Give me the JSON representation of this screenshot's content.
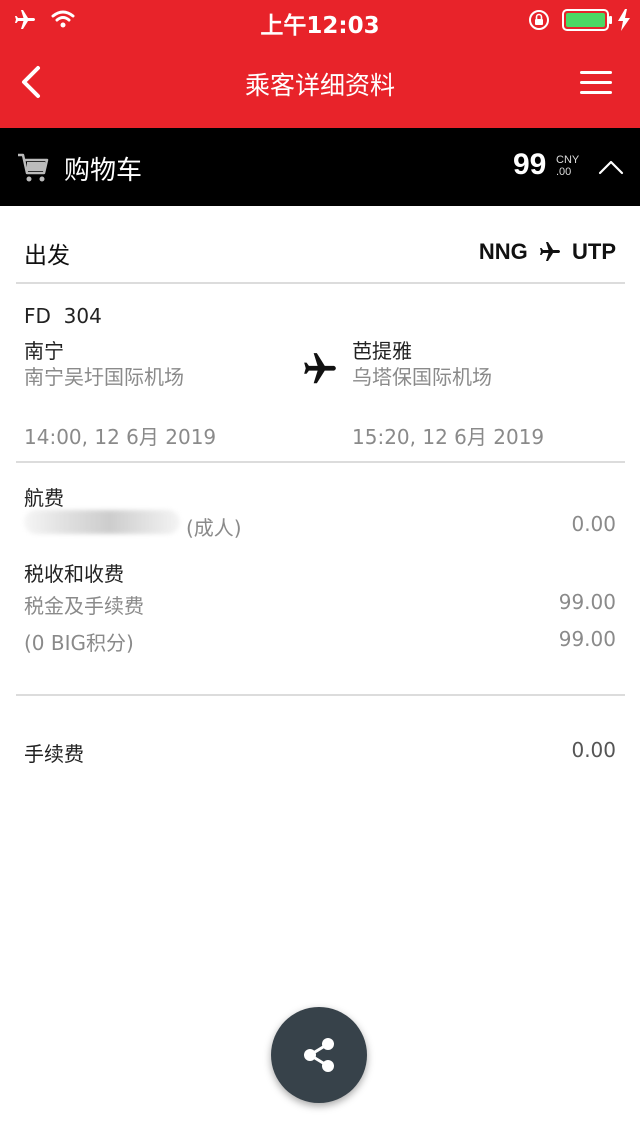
{
  "status_bar": {
    "time": "上午12:03",
    "icons": [
      "airplane-mode-icon",
      "wifi-icon",
      "rotation-lock-icon",
      "battery-icon",
      "charging-icon"
    ]
  },
  "nav": {
    "title": "乘客详细资料"
  },
  "cart": {
    "label": "购物车",
    "amount": "99",
    "currency": "CNY",
    "decimals": ".00"
  },
  "departure": {
    "label": "出发",
    "origin_code": "NNG",
    "destination_code": "UTP",
    "flight_number": "FD  304",
    "origin_city": "南宁",
    "origin_airport": "南宁吴圩国际机场",
    "destination_city": "芭提雅",
    "destination_airport": "乌塔保国际机场",
    "depart_time": "14:00, 12 6月 2019",
    "arrive_time": "15:20, 12 6月 2019"
  },
  "fares": {
    "airfare_label": "航费",
    "passenger_type": "(成人)",
    "airfare_value": "0.00",
    "taxes_label": "税收和收费",
    "taxes_item_label": "税金及手续费",
    "taxes_item_value": "99.00",
    "points_label": "(0 BIG积分)",
    "points_value": "99.00",
    "service_fee_label": "手续费",
    "service_fee_value": "0.00"
  },
  "colors": {
    "brand_red": "#e8232a",
    "cart_bar": "#000000",
    "fab": "#37424a",
    "muted_text": "#8a8a8a"
  }
}
